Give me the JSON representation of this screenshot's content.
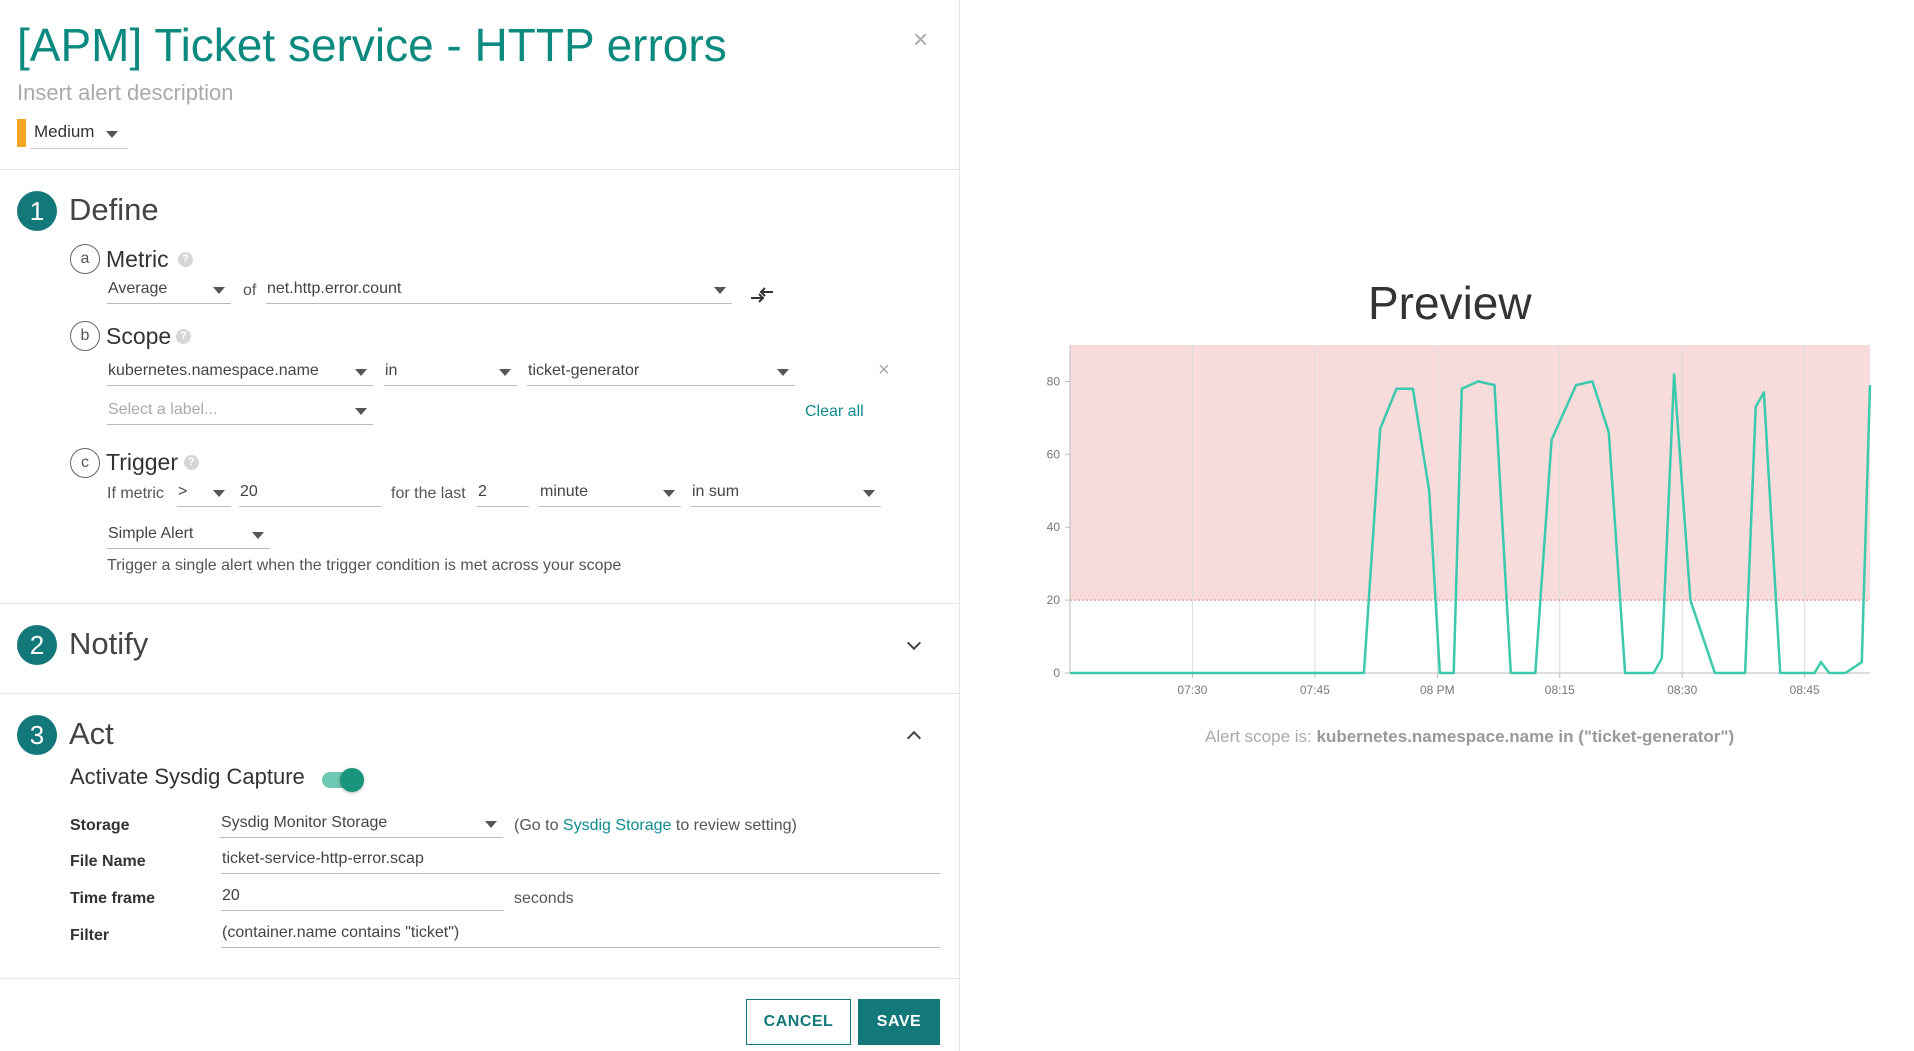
{
  "header": {
    "title": "[APM] Ticket service - HTTP errors",
    "close": "×",
    "description_placeholder": "Insert alert description",
    "severity": "Medium",
    "severity_color": "#f5a623"
  },
  "define": {
    "number": "1",
    "title": "Define",
    "metric": {
      "letter": "a",
      "title": "Metric",
      "aggregation": "Average",
      "of_label": "of",
      "metric_name": "net.http.error.count"
    },
    "scope": {
      "letter": "b",
      "title": "Scope",
      "label": "kubernetes.namespace.name",
      "operator": "in",
      "value": "ticket-generator",
      "label_placeholder": "Select a label...",
      "clear_all": "Clear all",
      "remove": "×"
    },
    "trigger": {
      "letter": "c",
      "title": "Trigger",
      "if_metric_label": "If metric",
      "comparator": ">",
      "threshold": "20",
      "for_the_last_label": "for the last",
      "duration": "2",
      "unit": "minute",
      "mode": "in sum",
      "alert_type": "Simple Alert",
      "alert_type_description": "Trigger a single alert when the trigger condition is met across your scope"
    }
  },
  "notify": {
    "number": "2",
    "title": "Notify"
  },
  "act": {
    "number": "3",
    "title": "Act",
    "capture_label": "Activate Sysdig Capture",
    "capture_enabled": true,
    "storage_label": "Storage",
    "storage_value": "Sysdig Monitor Storage",
    "storage_hint_prefix": "(Go to",
    "storage_hint_link": "Sysdig Storage",
    "storage_hint_suffix": "to review setting)",
    "file_name_label": "File Name",
    "file_name_value": "ticket-service-http-error.scap",
    "time_frame_label": "Time frame",
    "time_frame_value": "20",
    "time_frame_unit": "seconds",
    "filter_label": "Filter",
    "filter_value": "(container.name contains \"ticket\")"
  },
  "buttons": {
    "cancel": "CANCEL",
    "save": "SAVE"
  },
  "preview": {
    "title": "Preview",
    "scope_prefix": "Alert scope is:",
    "scope_value": "kubernetes.namespace.name in (\"ticket-generator\")"
  },
  "colors": {
    "accent": "#13787a",
    "title": "#0c8a80",
    "line": "#3cc9ac",
    "alert_fill": "#f8dcdc",
    "threshold_line": "#e27a7a"
  },
  "chart_data": {
    "type": "line",
    "title": "Preview",
    "xlabel": "",
    "ylabel": "",
    "ylim": [
      0,
      90
    ],
    "yticks": [
      0,
      20,
      40,
      60,
      80
    ],
    "xlim": [
      435,
      533
    ],
    "xtick_values": [
      450,
      465,
      480,
      495,
      510,
      525
    ],
    "xtick_labels": [
      "07:30",
      "07:45",
      "08 PM",
      "08:15",
      "08:30",
      "08:45"
    ],
    "threshold": 20,
    "grid": true,
    "legend": "none",
    "series": [
      {
        "x": [
          435,
          471,
          473,
          475,
          477,
          479,
          480.3,
          482,
          483,
          485,
          487,
          489,
          492,
          494,
          497,
          499,
          501,
          503,
          505,
          506.5,
          507.5,
          509,
          511,
          514,
          516,
          517.7,
          519,
          520,
          522,
          523,
          525,
          526.2,
          527,
          528,
          530,
          532,
          533
        ],
        "y": [
          0,
          0,
          67,
          78,
          78,
          50,
          0,
          0,
          78,
          80,
          79,
          0,
          0,
          64,
          79,
          80,
          66,
          0,
          0,
          0,
          4,
          82,
          20,
          0,
          0,
          0,
          73,
          77,
          0,
          0,
          0,
          0,
          3,
          0,
          0,
          3,
          79
        ]
      }
    ]
  }
}
